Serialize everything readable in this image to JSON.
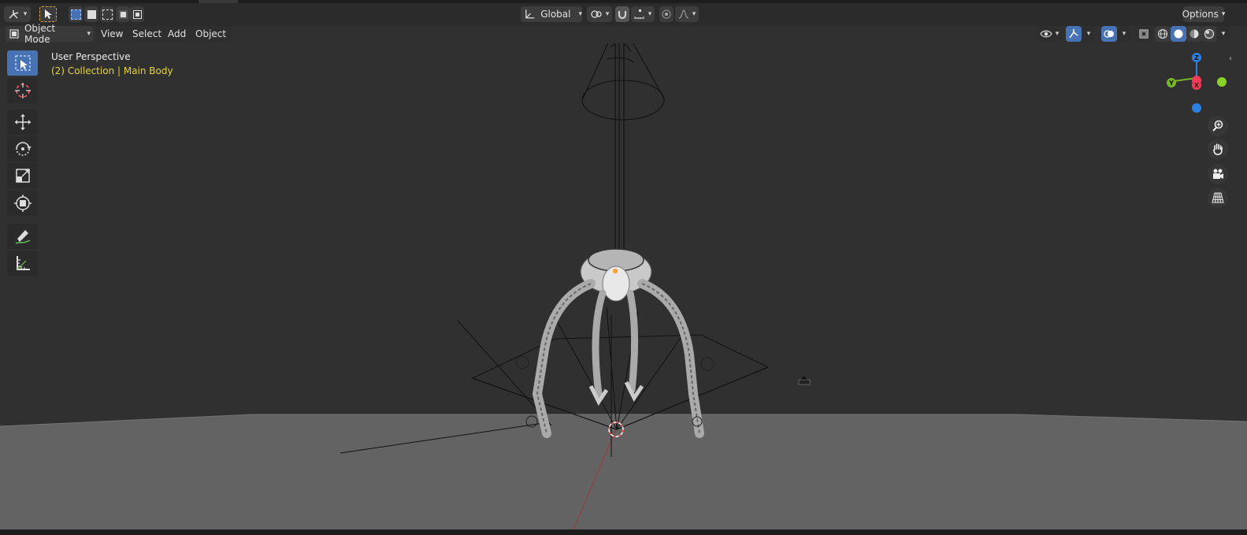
{
  "header": {
    "orientation_label": "Global",
    "options_label": "Options"
  },
  "menubar": {
    "mode_label": "Object Mode",
    "items": [
      "View",
      "Select",
      "Add",
      "Object"
    ]
  },
  "viewport": {
    "view_name": "User Perspective",
    "collection_info": "(2) Collection | Main Body"
  },
  "gizmo": {
    "x_label": "X",
    "y_label": "Y",
    "z_label": "Z"
  },
  "colors": {
    "accent": "#4772b3",
    "info_text": "#e6d33c",
    "axis_x": "#f23a58",
    "axis_y": "#79b528",
    "axis_z": "#2d7fe0"
  }
}
